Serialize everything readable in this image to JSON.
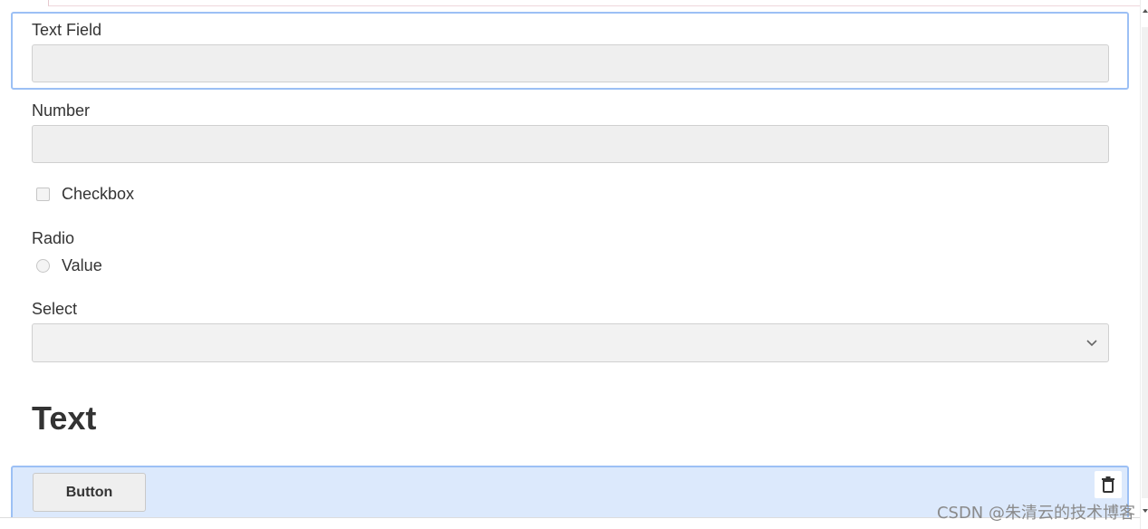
{
  "form": {
    "text_field_label": "Text Field",
    "text_field_value": "",
    "number_label": "Number",
    "number_value": "",
    "checkbox_label": "Checkbox",
    "radio_label": "Radio",
    "radio_option": "Value",
    "select_label": "Select",
    "select_value": "",
    "heading": "Text",
    "button_label": "Button"
  },
  "icons": {
    "delete": "trash-icon",
    "select_arrow": "chevron-down-icon"
  },
  "colors": {
    "selection_border": "#9cc0f5",
    "selected_panel_bg": "#dce9fc",
    "input_bg": "#efefef"
  },
  "watermark": "CSDN @朱清云的技术博客"
}
